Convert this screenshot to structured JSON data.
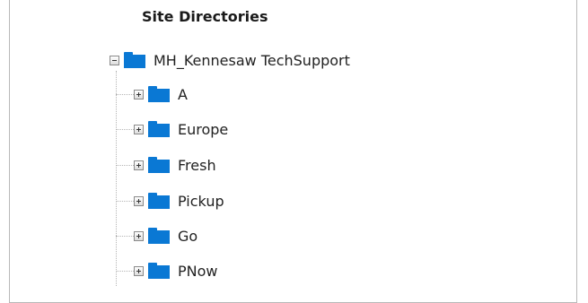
{
  "tree": {
    "title": "Site Directories",
    "root": {
      "label": "MH_Kennesaw TechSupport",
      "expanded": true,
      "icon": "folder-icon",
      "children": [
        {
          "label": "A",
          "expanded": false
        },
        {
          "label": "Europe",
          "expanded": false
        },
        {
          "label": "Fresh",
          "expanded": false
        },
        {
          "label": "Pickup",
          "expanded": false
        },
        {
          "label": "Go",
          "expanded": false
        },
        {
          "label": "PNow",
          "expanded": false
        }
      ]
    }
  },
  "colors": {
    "folder": "#0a78d4",
    "border": "#b8b8b8",
    "text": "#222222"
  }
}
